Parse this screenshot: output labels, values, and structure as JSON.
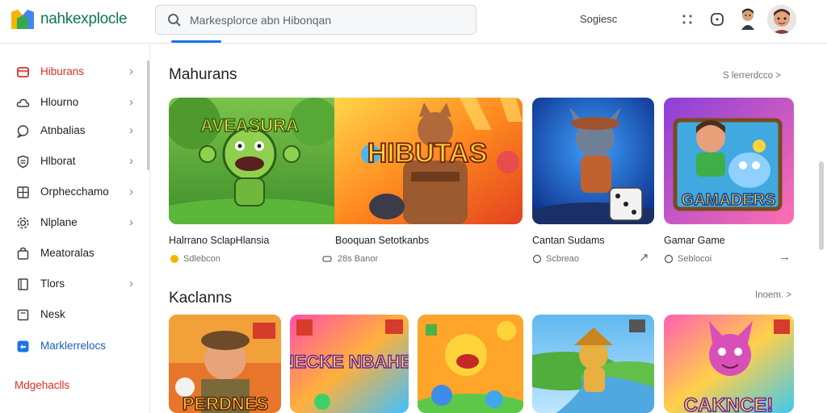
{
  "app": {
    "logo_text": "nahkexplocle"
  },
  "search": {
    "placeholder": "Markesplorce abn Hibonqan"
  },
  "header": {
    "signin_label": "Sogiesc"
  },
  "sidebar": {
    "items": [
      {
        "label": "Hiburans",
        "icon": "store-icon",
        "chevron": "›"
      },
      {
        "label": "Hlourno",
        "icon": "cloud-icon",
        "chevron": "›"
      },
      {
        "label": "Atnbalias",
        "icon": "chat-icon",
        "chevron": "›"
      },
      {
        "label": "Hlborat",
        "icon": "shield-icon",
        "chevron": "›"
      },
      {
        "label": "Orphecchamo",
        "icon": "grid-icon",
        "chevron": "›"
      },
      {
        "label": "Nlplane",
        "icon": "settings-icon",
        "chevron": "›"
      },
      {
        "label": "Meatoralas",
        "icon": "bag-icon",
        "chevron": ""
      },
      {
        "label": "Tlors",
        "icon": "book-icon",
        "chevron": "›"
      },
      {
        "label": "Nesk",
        "icon": "box-icon",
        "chevron": ""
      },
      {
        "label": "Marklerrelocs",
        "icon": "marketplace-icon",
        "chevron": ""
      },
      {
        "label": "Mdgehaclls",
        "icon": "",
        "chevron": ""
      }
    ]
  },
  "sections": [
    {
      "title": "Mahurans",
      "see_more": "S lerrerdcco >",
      "cards": [
        {
          "title": "Halrrano SclapHlansia",
          "meta": "Sdlebcon"
        },
        {
          "title": "Booquan Setotkanbs",
          "meta": "28s Banor"
        },
        {
          "title": "Cantan Sudams",
          "meta": "Scbreao"
        },
        {
          "title": "Gamar Game",
          "meta": "Seblocoi"
        }
      ]
    },
    {
      "title": "Kaclanns",
      "see_more": "Inoem. >",
      "cards": [
        {
          "banner": "PERDNES"
        },
        {
          "banner": "NECKE NBAHE!"
        },
        {
          "banner": ""
        },
        {
          "banner": ""
        },
        {
          "banner": "CAKNCE!"
        }
      ]
    }
  ],
  "cards_art_text": {
    "card1": "AVEASURA",
    "card2": "HIBUTAS",
    "card4": "GAMADERS"
  },
  "colors": {
    "accent": "#1a73e8",
    "brand_green": "#0b7a4b",
    "active_red": "#d93025"
  }
}
